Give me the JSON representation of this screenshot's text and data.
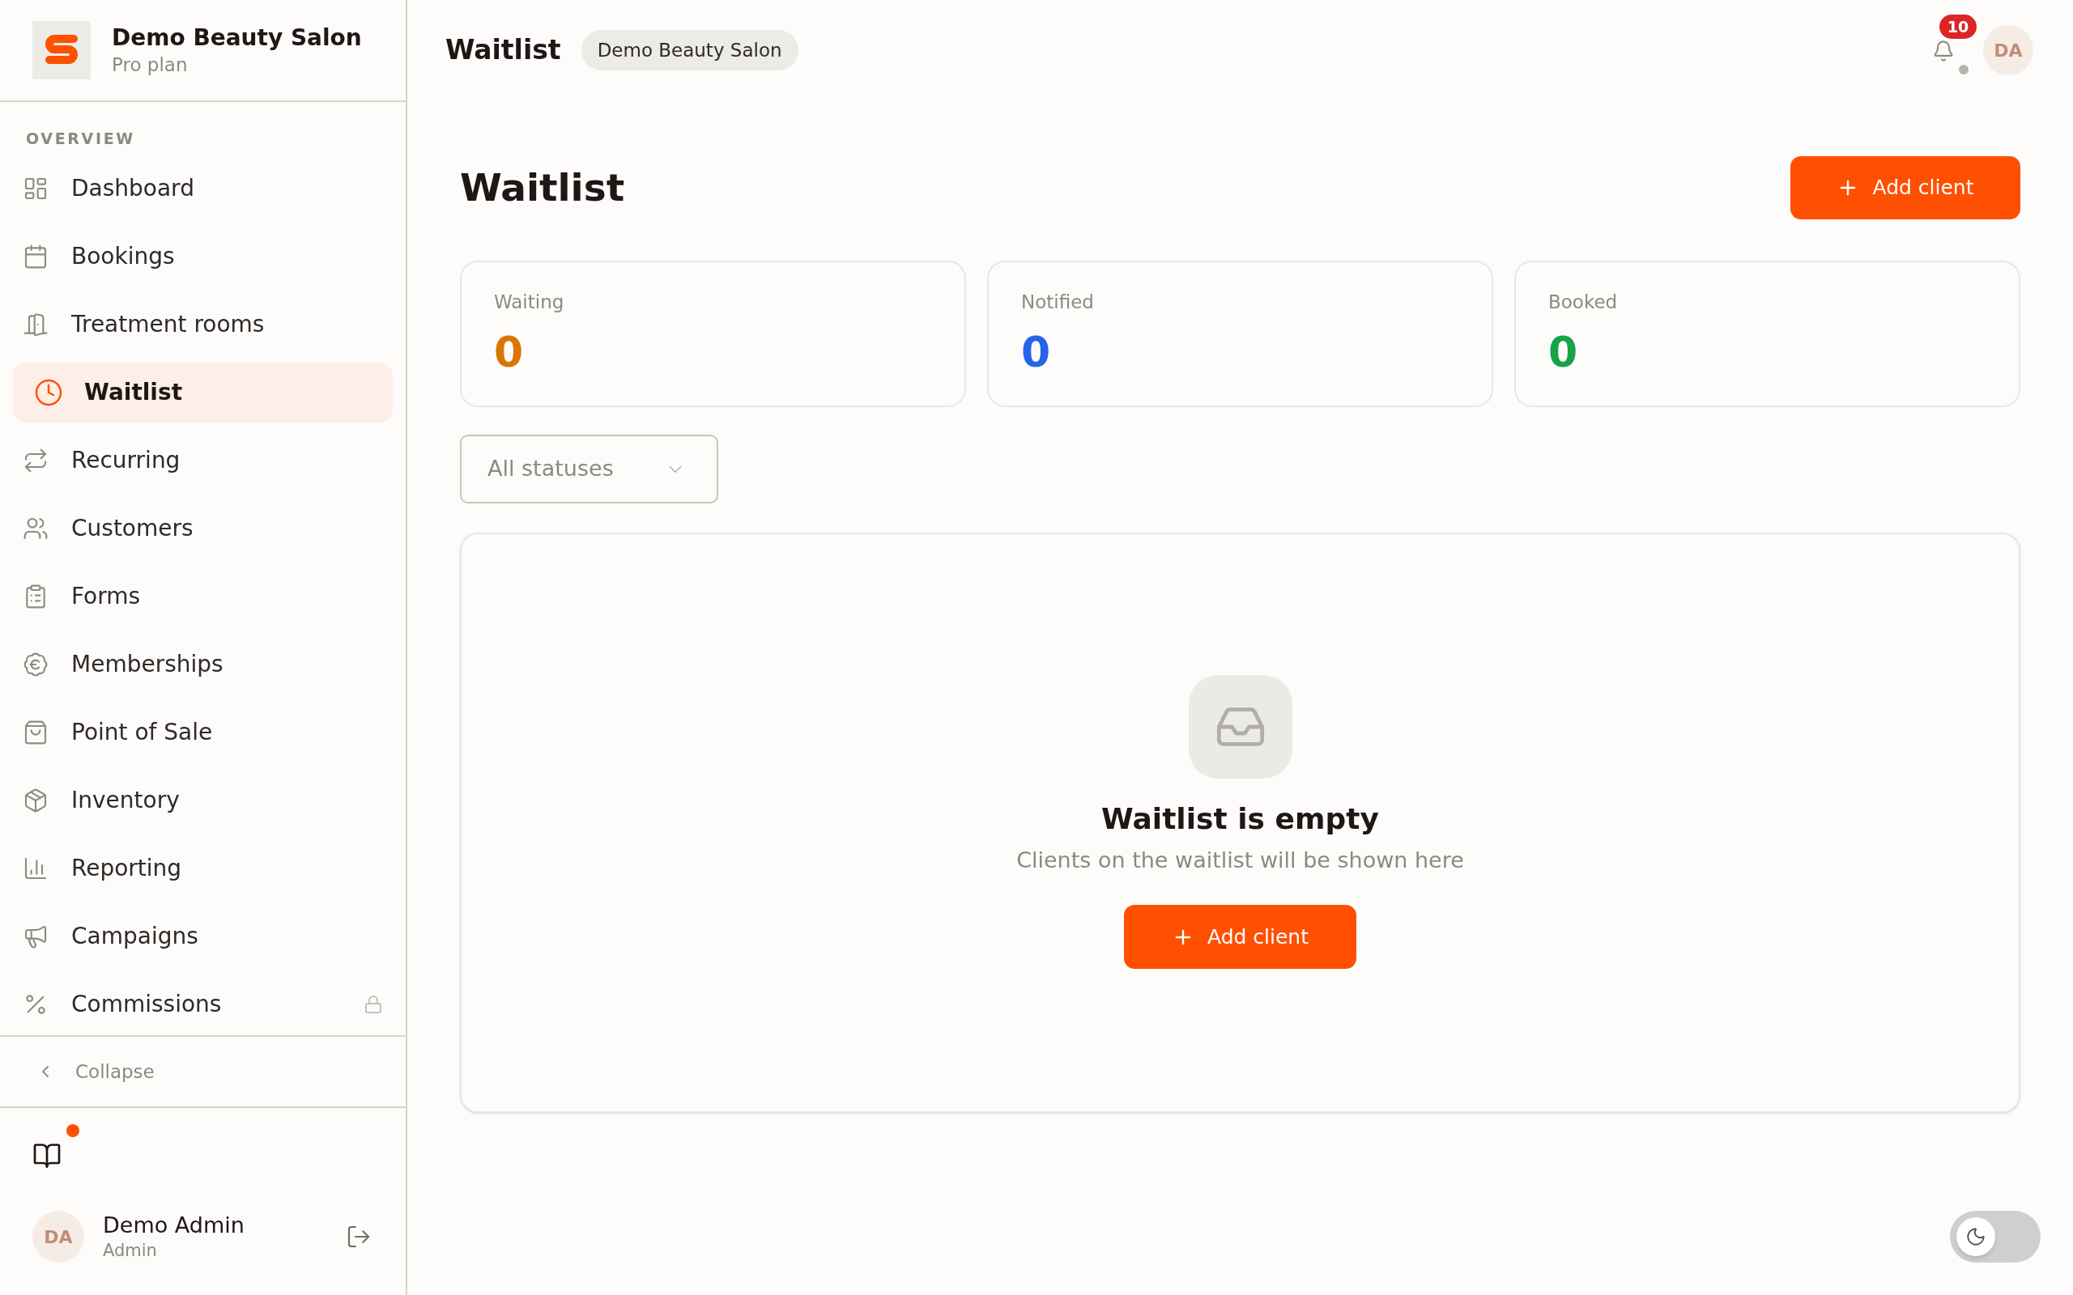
{
  "sidebar": {
    "brand": {
      "name": "Demo Beauty Salon",
      "plan": "Pro plan"
    },
    "section_label": "OVERVIEW",
    "items": [
      {
        "label": "Dashboard",
        "selected": false,
        "locked": false
      },
      {
        "label": "Bookings",
        "selected": false,
        "locked": false
      },
      {
        "label": "Treatment rooms",
        "selected": false,
        "locked": false
      },
      {
        "label": "Waitlist",
        "selected": true,
        "locked": false
      },
      {
        "label": "Recurring",
        "selected": false,
        "locked": false
      },
      {
        "label": "Customers",
        "selected": false,
        "locked": false
      },
      {
        "label": "Forms",
        "selected": false,
        "locked": false
      },
      {
        "label": "Memberships",
        "selected": false,
        "locked": false
      },
      {
        "label": "Point of Sale",
        "selected": false,
        "locked": false
      },
      {
        "label": "Inventory",
        "selected": false,
        "locked": false
      },
      {
        "label": "Reporting",
        "selected": false,
        "locked": false
      },
      {
        "label": "Campaigns",
        "selected": false,
        "locked": false
      },
      {
        "label": "Commissions",
        "selected": false,
        "locked": true
      }
    ],
    "collapse": "Collapse",
    "guide": {
      "has_update": true
    },
    "user": {
      "initials": "DA",
      "name": "Demo Admin",
      "role": "Admin"
    }
  },
  "header": {
    "title": "Waitlist",
    "workspace": "Demo Beauty Salon",
    "notification_count": "10",
    "avatar_initials": "DA"
  },
  "page": {
    "title": "Waitlist",
    "add_button": "Add client"
  },
  "stats": [
    {
      "label": "Waiting",
      "value": "0",
      "color": "#d97706"
    },
    {
      "label": "Notified",
      "value": "0",
      "color": "#2563eb"
    },
    {
      "label": "Booked",
      "value": "0",
      "color": "#16a34a"
    }
  ],
  "filter": {
    "value": "All statuses"
  },
  "empty_state": {
    "title": "Waitlist is empty",
    "description": "Clients on the waitlist will be shown here",
    "button": "Add client"
  },
  "theme_toggle": {
    "on": false
  }
}
